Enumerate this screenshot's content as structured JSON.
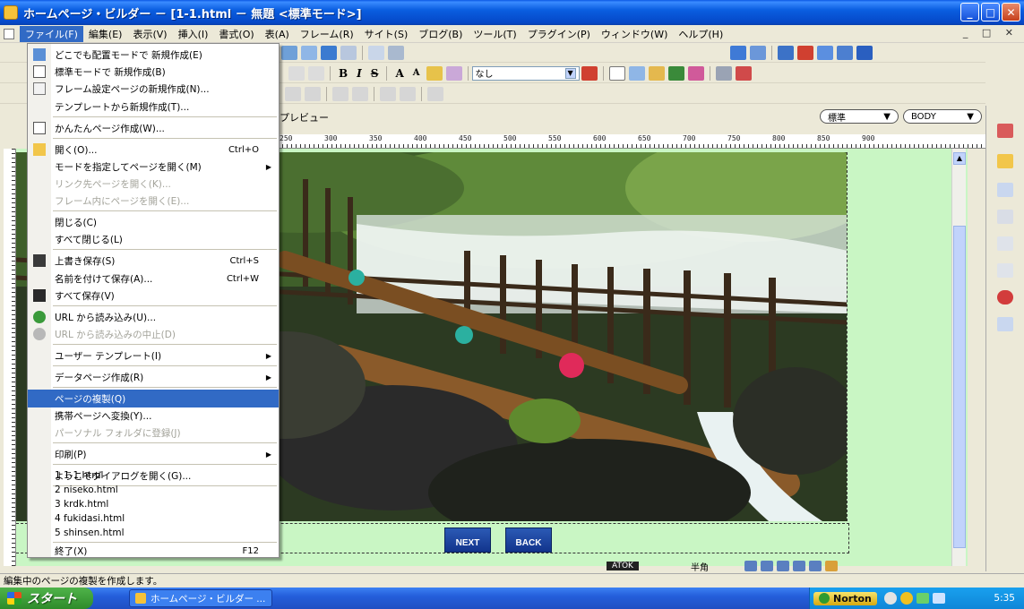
{
  "window": {
    "title": "ホームページ・ビルダー － [1-1.html － 無題 <標準モード>]",
    "controls": [
      "_",
      "□",
      "✕"
    ]
  },
  "menubar": {
    "items": [
      "ファイル(F)",
      "編集(E)",
      "表示(V)",
      "挿入(I)",
      "書式(O)",
      "表(A)",
      "フレーム(R)",
      "サイト(S)",
      "ブログ(B)",
      "ツール(T)",
      "プラグイン(P)",
      "ウィンドウ(W)",
      "ヘルプ(H)"
    ],
    "mdi_controls": "_ □ ✕"
  },
  "toolbar": {
    "style_select": "なし",
    "preview_tab": "プレビュー",
    "mode_select": "標準",
    "element_select": "BODY"
  },
  "ruler": {
    "ticks": [
      "250",
      "300",
      "350",
      "400",
      "450",
      "500",
      "550",
      "600",
      "650",
      "700",
      "750",
      "800",
      "850",
      "900"
    ]
  },
  "file_menu": {
    "items": [
      {
        "label": "どこでも配置モードで 新規作成(E)",
        "shortcut": "",
        "submenu": false,
        "disabled": false
      },
      {
        "label": "標準モードで 新規作成(B)",
        "shortcut": "",
        "submenu": false,
        "disabled": false
      },
      {
        "label": "フレーム設定ページの新規作成(N)...",
        "shortcut": "",
        "submenu": false,
        "disabled": false
      },
      {
        "label": "テンプレートから新規作成(T)...",
        "shortcut": "",
        "submenu": false,
        "disabled": false
      },
      {
        "label": "かんたんページ作成(W)...",
        "shortcut": "",
        "submenu": false,
        "disabled": false
      },
      {
        "label": "開く(O)...",
        "shortcut": "Ctrl+O",
        "submenu": false,
        "disabled": false
      },
      {
        "label": "モードを指定してページを開く(M)",
        "shortcut": "",
        "submenu": true,
        "disabled": false
      },
      {
        "label": "リンク先ページを開く(K)...",
        "shortcut": "",
        "submenu": false,
        "disabled": true
      },
      {
        "label": "フレーム内にページを開く(E)...",
        "shortcut": "",
        "submenu": false,
        "disabled": true
      },
      {
        "label": "閉じる(C)",
        "shortcut": "",
        "submenu": false,
        "disabled": false
      },
      {
        "label": "すべて閉じる(L)",
        "shortcut": "",
        "submenu": false,
        "disabled": false
      },
      {
        "label": "上書き保存(S)",
        "shortcut": "Ctrl+S",
        "submenu": false,
        "disabled": false
      },
      {
        "label": "名前を付けて保存(A)...",
        "shortcut": "Ctrl+W",
        "submenu": false,
        "disabled": false
      },
      {
        "label": "すべて保存(V)",
        "shortcut": "",
        "submenu": false,
        "disabled": false
      },
      {
        "label": "URL から読み込み(U)...",
        "shortcut": "",
        "submenu": false,
        "disabled": false
      },
      {
        "label": "URL から読み込みの中止(D)",
        "shortcut": "",
        "submenu": false,
        "disabled": true
      },
      {
        "label": "ユーザー テンプレート(I)",
        "shortcut": "",
        "submenu": true,
        "disabled": false
      },
      {
        "label": "データページ作成(R)",
        "shortcut": "",
        "submenu": true,
        "disabled": false
      },
      {
        "label": "ページの複製(Q)",
        "shortcut": "",
        "submenu": false,
        "disabled": false,
        "highlight": true
      },
      {
        "label": "携帯ページへ変換(Y)...",
        "shortcut": "",
        "submenu": false,
        "disabled": false
      },
      {
        "label": "パーソナル フォルダに登録(J)",
        "shortcut": "",
        "submenu": false,
        "disabled": true
      },
      {
        "label": "印刷(P)",
        "shortcut": "",
        "submenu": true,
        "disabled": false
      },
      {
        "label": "ようこそダイアログを開く(G)...",
        "shortcut": "",
        "submenu": false,
        "disabled": false
      },
      {
        "label": "1 1-1.html",
        "shortcut": "",
        "submenu": false,
        "disabled": false
      },
      {
        "label": "2 niseko.html",
        "shortcut": "",
        "submenu": false,
        "disabled": false
      },
      {
        "label": "3 krdk.html",
        "shortcut": "",
        "submenu": false,
        "disabled": false
      },
      {
        "label": "4 fukidasi.html",
        "shortcut": "",
        "submenu": false,
        "disabled": false
      },
      {
        "label": "5 shinsen.html",
        "shortcut": "",
        "submenu": false,
        "disabled": false
      },
      {
        "label": "終了(X)",
        "shortcut": "F12",
        "submenu": false,
        "disabled": false
      }
    ]
  },
  "page": {
    "next_button": "NEXT",
    "back_button": "BACK"
  },
  "statusbar": {
    "message": "編集中のページの複製を作成します。",
    "ime": "ATOK",
    "ime_mode": "半角"
  },
  "taskbar": {
    "start": "スタート",
    "task": "ホームページ・ビルダー ...",
    "norton": "Norton",
    "clock": "5:35"
  },
  "colors": {
    "accent": "#316ac5",
    "editor_background": "#c9f6c4",
    "taskbar": "#245edb"
  }
}
